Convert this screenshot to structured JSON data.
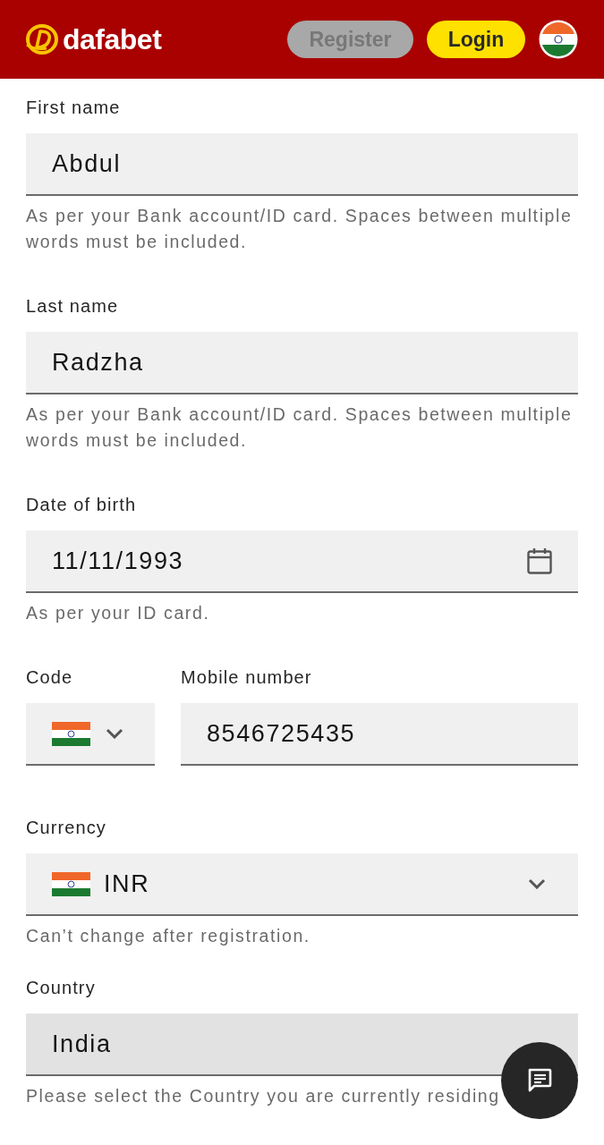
{
  "header": {
    "brand": "dafabet",
    "buttons": [
      {
        "kind": "secondary",
        "label": "Register"
      },
      {
        "kind": "primary",
        "label": "Login"
      }
    ]
  },
  "form": {
    "fields": [
      {
        "kind": "text",
        "label": "First name",
        "value": "Abdul",
        "disabled": false,
        "help": "As per your Bank account/ID card. Spaces between multiple words must be included."
      },
      {
        "kind": "text",
        "label": "Last name",
        "value": "Radzha",
        "disabled": false,
        "help": "As per your Bank account/ID card. Spaces between multiple words must be included."
      },
      {
        "kind": "date",
        "label": "Date of birth",
        "value": "11/11/1993",
        "disabled": false,
        "help": "As per your ID card."
      },
      {
        "kind": "phone",
        "code_label": "Code",
        "label": "Mobile number",
        "value": "8546725435",
        "disabled": false
      },
      {
        "kind": "select",
        "label": "Currency",
        "value": "INR",
        "flag": true,
        "disabled": false,
        "help": "Can’t change after registration."
      },
      {
        "kind": "select",
        "label": "Country",
        "value": "India",
        "flag": false,
        "disabled": true,
        "help": "Please select the Country you are currently residing"
      }
    ]
  }
}
